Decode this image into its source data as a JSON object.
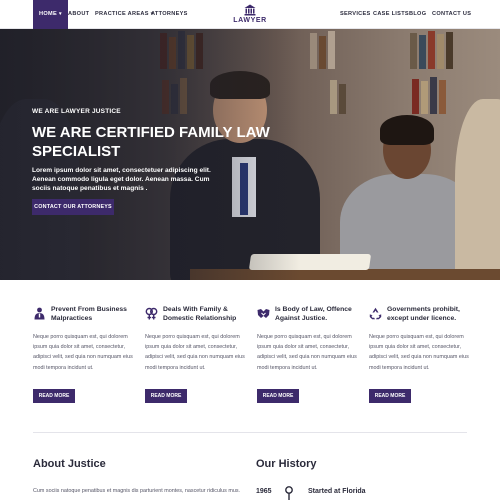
{
  "nav": {
    "left_items": [
      {
        "label": "HOME"
      },
      {
        "label": "ABOUT"
      },
      {
        "label": "PRACTICE AREAS"
      },
      {
        "label": "ATTORNEYS"
      }
    ],
    "right_items": [
      {
        "label": "SERVICES"
      },
      {
        "label": "CASE LISTS"
      },
      {
        "label": "BLOG"
      },
      {
        "label": "CONTACT US"
      }
    ],
    "logo_text": "LAWYER"
  },
  "hero": {
    "kicker": "WE ARE LAWYER JUSTICE",
    "title": "WE ARE CERTIFIED FAMILY LAW SPECIALIST",
    "text": "Lorem ipsum dolor sit amet, consectetuer adipiscing elit. Aenean commodo ligula eget dolor. Aenean massa. Cum sociis natoque penatibus et magnis .",
    "button": "CONTACT OUR ATTORNEYS"
  },
  "features": [
    {
      "icon": "lawyer-icon",
      "title": "Prevent From Business Malpractices",
      "text": "Neque porro quisquam est, qui dolorem ipsum quia dolor sit amet, consectetur, adipisci velit, sed quia non numquam eius modi tempora incidunt ut.",
      "button": "READ MORE"
    },
    {
      "icon": "gender-icon",
      "title": "Deals With Family & Domestic Relationship",
      "text": "Neque porro quisquam est, qui dolorem ipsum quia dolor sit amet, consectetur, adipisci velit, sed quia non numquam eius modi tempora incidunt ut.",
      "button": "READ MORE"
    },
    {
      "icon": "handshake-icon",
      "title": "Is Body of Law, Offence Against Justice.",
      "text": "Neque porro quisquam est, qui dolorem ipsum quia dolor sit amet, consectetur, adipisci velit, sed quia non numquam eius modi tempora incidunt ut.",
      "button": "READ MORE"
    },
    {
      "icon": "recycle-icon",
      "title": "Governments prohibit, except under licence.",
      "text": "Neque porro quisquam est, qui dolorem ipsum quia dolor sit amet, consectetur, adipisci velit, sed quia non numquam eius modi tempora incidunt ut.",
      "button": "READ MORE"
    }
  ],
  "about": {
    "title": "About Justice",
    "text": "Cum sociis natoque penatibus et magnis dis parturient montes, nascetur ridiculus mus."
  },
  "history": {
    "title": "Our History",
    "year": "1965",
    "event": "Started at Florida"
  },
  "colors": {
    "brand": "#3d2a6b",
    "text": "#2a2a3a"
  }
}
